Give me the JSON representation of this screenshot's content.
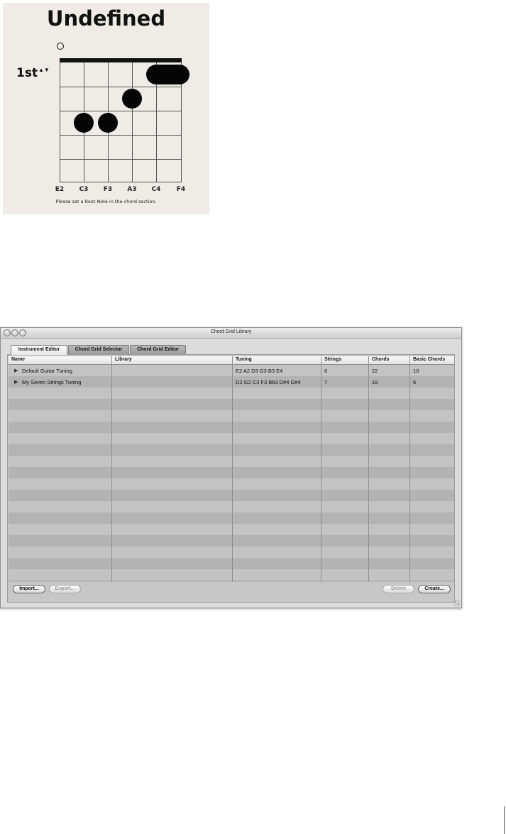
{
  "chord_diagram": {
    "title": "Undefined",
    "fret_position": "1st",
    "stepper_glyph": "▲▼",
    "string_labels": [
      "E2",
      "C3",
      "F3",
      "A3",
      "C4",
      "F4"
    ],
    "message": "Please set a Root Note in the chord section."
  },
  "window": {
    "title": "Chord Grid Library",
    "tabs": [
      {
        "label": "Instrument Editor",
        "active": true
      },
      {
        "label": "Chord Grid Selector",
        "active": false
      },
      {
        "label": "Chord Grid Editor",
        "active": false
      }
    ],
    "columns": [
      "Name",
      "Library",
      "Tuning",
      "Strings",
      "Chords",
      "Basic Chords"
    ],
    "rows": [
      {
        "name": "Default Guitar Tuning",
        "library": "",
        "tuning": "E2 A2 D3 G3 B3 E4",
        "strings": "6",
        "chords": "22",
        "basic_chords": "10"
      },
      {
        "name": "My Seven Strings Tuning",
        "library": "",
        "tuning": "D2 G2 C3 F3 Bb3 D#4 G#4",
        "strings": "7",
        "chords": "18",
        "basic_chords": "6"
      }
    ],
    "disclosure_glyph": "▶",
    "buttons": {
      "import": "Import...",
      "export": "Export...",
      "delete": "Delete",
      "create": "Create..."
    }
  }
}
